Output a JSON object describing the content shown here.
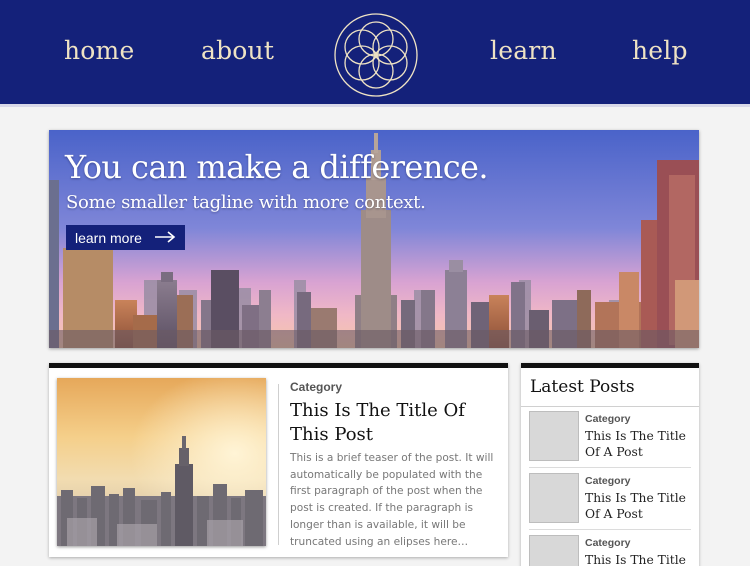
{
  "nav": {
    "items": [
      {
        "label": "home"
      },
      {
        "label": "about"
      },
      {
        "label": "learn"
      },
      {
        "label": "help"
      }
    ]
  },
  "hero": {
    "title": "You can make a difference.",
    "tagline": "Some smaller tagline with more context.",
    "button_label": "learn more"
  },
  "post": {
    "category": "Category",
    "title": "This Is The Title Of This Post",
    "teaser": "This is a brief teaser of the post. It will automatically be populated with the first paragraph of the post when the post is created. If the paragraph is longer than is available, it will be truncated using an elipses here…"
  },
  "sidebar": {
    "title": "Latest Posts",
    "items": [
      {
        "category": "Category",
        "title": "This Is The Title Of A Post"
      },
      {
        "category": "Category",
        "title": "This Is The Title Of A Post"
      },
      {
        "category": "Category",
        "title": "This Is The Title Of A Post"
      }
    ]
  },
  "colors": {
    "brand_navy": "#14217a",
    "nav_text": "#efe3c4",
    "background": "#f3f3f3"
  },
  "icons": {
    "logo": "flower-of-life-logo-icon",
    "button_arrow": "arrow-right-icon"
  }
}
